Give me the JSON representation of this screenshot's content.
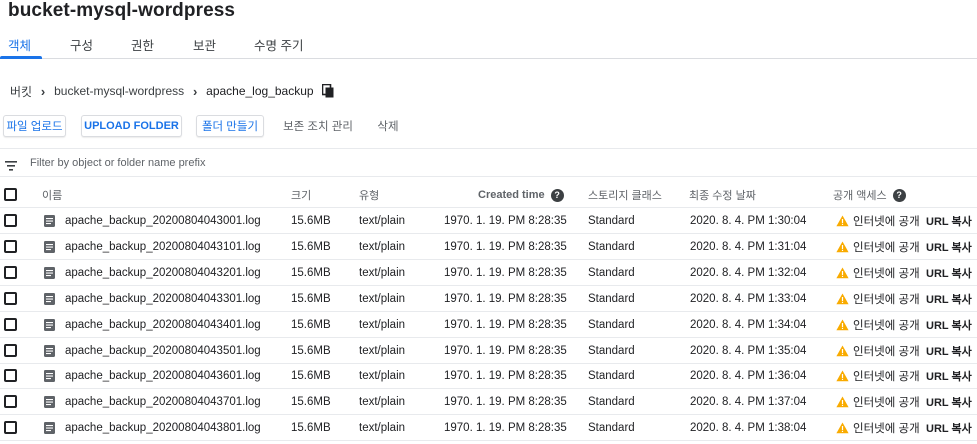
{
  "title": "bucket-mysql-wordpress",
  "tabs": [
    {
      "label": "객체"
    },
    {
      "label": "구성"
    },
    {
      "label": "권한"
    },
    {
      "label": "보관"
    },
    {
      "label": "수명 주기"
    }
  ],
  "breadcrumb": {
    "root": "버킷",
    "bucket": "bucket-mysql-wordpress",
    "folder": "apache_log_backup"
  },
  "toolbar": {
    "upload_files": "파일 업로드",
    "upload_folder": "UPLOAD FOLDER",
    "create_folder": "폴더 만들기",
    "retention": "보존 조치 관리",
    "delete": "삭제"
  },
  "filter": {
    "placeholder": "Filter by object or folder name prefix"
  },
  "columns": {
    "name": "이름",
    "size": "크기",
    "type": "유형",
    "created": "Created time",
    "storage_class": "스토리지 클래스",
    "modified": "최종 수정 날짜",
    "public_access": "공개 액세스"
  },
  "rows": [
    {
      "name": "apache_backup_20200804043001.log",
      "size": "15.6MB",
      "type": "text/plain",
      "created": "1970. 1. 19. PM 8:28:35",
      "storage_class": "Standard",
      "modified": "2020. 8. 4. PM 1:30:04",
      "access": "인터넷에 공개",
      "url": "URL 복사"
    },
    {
      "name": "apache_backup_20200804043101.log",
      "size": "15.6MB",
      "type": "text/plain",
      "created": "1970. 1. 19. PM 8:28:35",
      "storage_class": "Standard",
      "modified": "2020. 8. 4. PM 1:31:04",
      "access": "인터넷에 공개",
      "url": "URL 복사"
    },
    {
      "name": "apache_backup_20200804043201.log",
      "size": "15.6MB",
      "type": "text/plain",
      "created": "1970. 1. 19. PM 8:28:35",
      "storage_class": "Standard",
      "modified": "2020. 8. 4. PM 1:32:04",
      "access": "인터넷에 공개",
      "url": "URL 복사"
    },
    {
      "name": "apache_backup_20200804043301.log",
      "size": "15.6MB",
      "type": "text/plain",
      "created": "1970. 1. 19. PM 8:28:35",
      "storage_class": "Standard",
      "modified": "2020. 8. 4. PM 1:33:04",
      "access": "인터넷에 공개",
      "url": "URL 복사"
    },
    {
      "name": "apache_backup_20200804043401.log",
      "size": "15.6MB",
      "type": "text/plain",
      "created": "1970. 1. 19. PM 8:28:35",
      "storage_class": "Standard",
      "modified": "2020. 8. 4. PM 1:34:04",
      "access": "인터넷에 공개",
      "url": "URL 복사"
    },
    {
      "name": "apache_backup_20200804043501.log",
      "size": "15.6MB",
      "type": "text/plain",
      "created": "1970. 1. 19. PM 8:28:35",
      "storage_class": "Standard",
      "modified": "2020. 8. 4. PM 1:35:04",
      "access": "인터넷에 공개",
      "url": "URL 복사"
    },
    {
      "name": "apache_backup_20200804043601.log",
      "size": "15.6MB",
      "type": "text/plain",
      "created": "1970. 1. 19. PM 8:28:35",
      "storage_class": "Standard",
      "modified": "2020. 8. 4. PM 1:36:04",
      "access": "인터넷에 공개",
      "url": "URL 복사"
    },
    {
      "name": "apache_backup_20200804043701.log",
      "size": "15.6MB",
      "type": "text/plain",
      "created": "1970. 1. 19. PM 8:28:35",
      "storage_class": "Standard",
      "modified": "2020. 8. 4. PM 1:37:04",
      "access": "인터넷에 공개",
      "url": "URL 복사"
    },
    {
      "name": "apache_backup_20200804043801.log",
      "size": "15.6MB",
      "type": "text/plain",
      "created": "1970. 1. 19. PM 8:28:35",
      "storage_class": "Standard",
      "modified": "2020. 8. 4. PM 1:38:04",
      "access": "인터넷에 공개",
      "url": "URL 복사"
    }
  ],
  "colors": {
    "accent": "#1a73e8",
    "warning": "#f9ab00",
    "text": "#202124",
    "divider": "#e8eaed"
  },
  "icons": {
    "copy": "copy-icon",
    "filter": "filter-list-icon",
    "file": "document-icon",
    "help": "help-icon",
    "warning": "warning-icon"
  }
}
